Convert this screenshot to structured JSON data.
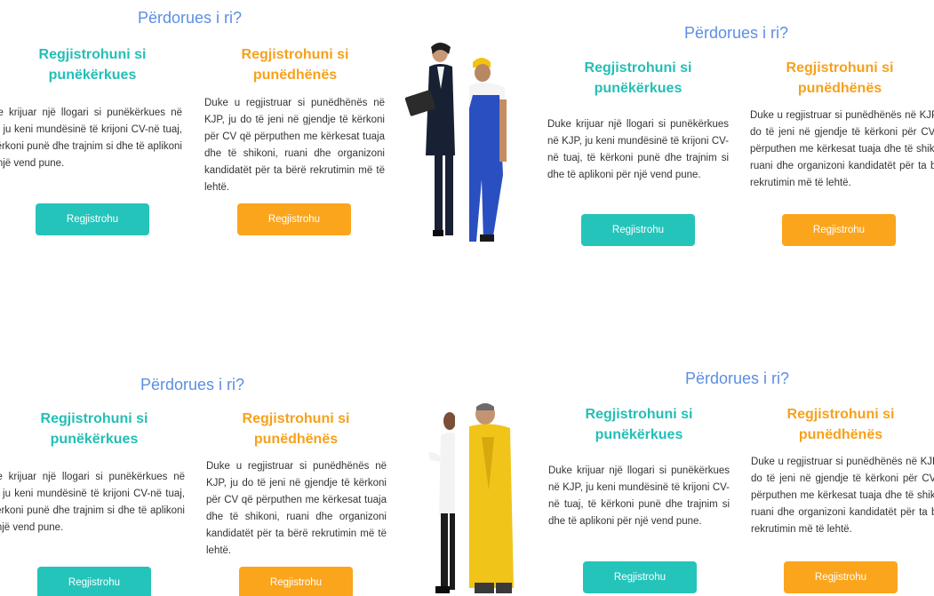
{
  "panels": [
    {
      "title": "Përdorues i ri?",
      "jobseeker": {
        "heading_line1": "Regjistrohuni si",
        "heading_line2": "punëkërkues",
        "description": "Duke krijuar një llogari si punëkërkues në KJP, ju keni mundësinë të krijoni CV-në tuaj, të kërkoni punë dhe trajnim si dhe të aplikoni për një vend pune.",
        "button": "Regjistrohu"
      },
      "employer": {
        "heading_line1": "Regjistrohuni si",
        "heading_line2": "punëdhënës",
        "description": "Duke u regjistruar si punëdhënës në KJP, ju do të jeni në gjendje të kërkoni për CV që përputhen me kërkesat tuaja dhe të shikoni, ruani dhe organizoni kandidatët për ta bërë rekrutimin më të lehtë.",
        "button": "Regjistrohu"
      }
    },
    {
      "title": "Përdorues i ri?",
      "jobseeker": {
        "heading_line1": "Regjistrohuni si",
        "heading_line2": "punëkërkues",
        "description": "Duke krijuar një llogari si punëkërkues në KJP, ju keni mundësinë të krijoni CV-në tuaj, të kërkoni punë dhe trajnim si dhe të aplikoni për një vend pune.",
        "button": "Regjistrohu"
      },
      "employer": {
        "heading_line1": "Regjistrohuni si",
        "heading_line2": "punëdhënës",
        "description": "Duke u regjistruar si punëdhënës në KJP, ju do të jeni në gjendje të kërkoni për CV që përputhen me kërkesat tuaja dhe të shikoni, ruani dhe organizoni kandidatët për ta bërë rekrutimin më të lehtë.",
        "button": "Regjistrohu"
      }
    },
    {
      "title": "Përdorues i ri?",
      "jobseeker": {
        "heading_line1": "Regjistrohuni si",
        "heading_line2": "punëkërkues",
        "description": "Duke krijuar një llogari si punëkërkues në KJP, ju keni mundësinë të krijoni CV-në tuaj, të kërkoni punë dhe trajnim si dhe të aplikoni për një vend pune.",
        "button": "Regjistrohu"
      },
      "employer": {
        "heading_line1": "Regjistrohuni si",
        "heading_line2": "punëdhënës",
        "description": "Duke u regjistruar si punëdhënës në KJP, ju do të jeni në gjendje të kërkoni për CV që përputhen me kërkesat tuaja dhe të shikoni, ruani dhe organizoni kandidatët për ta bërë rekrutimin më të lehtë.",
        "button": "Regjistrohu"
      }
    },
    {
      "title": "Përdorues i ri?",
      "jobseeker": {
        "heading_line1": "Regjistrohuni si",
        "heading_line2": "punëkërkues",
        "description": "Duke krijuar një llogari si punëkërkues në KJP, ju keni mundësinë të krijoni CV-në tuaj, të kërkoni punë dhe trajnim si dhe të aplikoni për një vend pune.",
        "button": "Regjistrohu"
      },
      "employer": {
        "heading_line1": "Regjistrohuni si",
        "heading_line2": "punëdhënës",
        "description": "Duke u regjistruar si punëdhënës në KJP, ju do të jeni në gjendje të kërkoni për CV që përputhen me kërkesat tuaja dhe të shikoni, ruani dhe organizoni kandidatët për ta bërë rekrutimin më të lehtë.",
        "button": "Regjistrohu"
      }
    }
  ],
  "colors": {
    "title": "#5b8fe3",
    "jobseeker_accent": "#24c4bb",
    "employer_accent": "#fba51c"
  }
}
